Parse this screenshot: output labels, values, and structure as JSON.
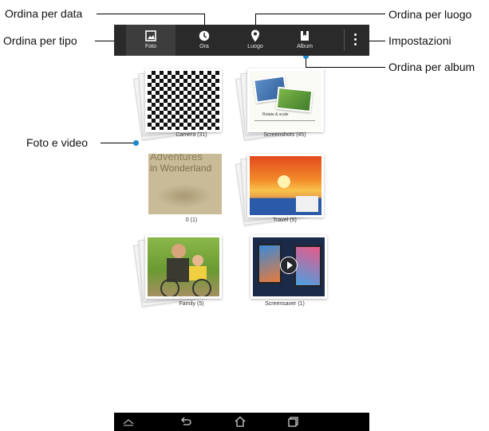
{
  "toolbar": {
    "tabs": [
      {
        "label": "Foto",
        "icon": "photo-icon"
      },
      {
        "label": "Ora",
        "icon": "clock-icon"
      },
      {
        "label": "Luogo",
        "icon": "location-pin-icon"
      },
      {
        "label": "Album",
        "icon": "album-icon"
      }
    ],
    "menu_icon": "overflow-menu-icon"
  },
  "annotations": {
    "sort_by_date": "Ordina per data",
    "sort_by_type": "Ordina per tipo",
    "sort_by_place": "Ordina per luogo",
    "settings": "Impostazioni",
    "sort_by_album": "Ordina per album",
    "photos_videos": "Foto e video"
  },
  "albums": [
    {
      "caption": "Camera (31)"
    },
    {
      "caption": "Screenshots (45)",
      "overlay": "Rotate & scale"
    },
    {
      "caption": "0 (1)",
      "overlay1": "Adventures",
      "overlay2": "in Wonderland"
    },
    {
      "caption": "Travel (5)"
    },
    {
      "caption": "Family (5)"
    },
    {
      "caption": "Screensaver (1)"
    }
  ],
  "colors": {
    "bar": "#2a2a2a",
    "accent_dot": "#1a88c9",
    "navbar": "#000000"
  },
  "navbar": {
    "icons": [
      "up-chevron-icon",
      "back-icon",
      "home-icon",
      "recents-icon"
    ]
  }
}
